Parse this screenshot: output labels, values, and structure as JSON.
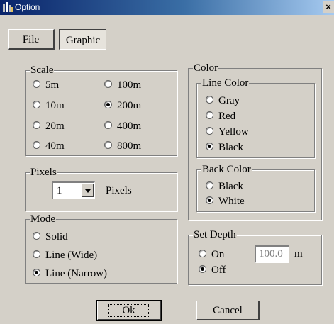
{
  "window": {
    "title": "Option",
    "close_label": "×"
  },
  "tabs": [
    {
      "label": "File",
      "active": false
    },
    {
      "label": "Graphic",
      "active": true
    }
  ],
  "scale": {
    "legend": "Scale",
    "options": [
      "5m",
      "10m",
      "20m",
      "40m",
      "100m",
      "200m",
      "400m",
      "800m"
    ],
    "selected": "200m"
  },
  "pixels": {
    "legend": "Pixels",
    "value": "1",
    "unit": "Pixels"
  },
  "mode": {
    "legend": "Mode",
    "options": [
      "Solid",
      "Line (Wide)",
      "Line (Narrow)"
    ],
    "selected": "Line (Narrow)"
  },
  "color": {
    "legend": "Color",
    "line_color": {
      "legend": "Line Color",
      "options": [
        "Gray",
        "Red",
        "Yellow",
        "Black"
      ],
      "selected": "Black"
    },
    "back_color": {
      "legend": "Back Color",
      "options": [
        "Black",
        "White"
      ],
      "selected": "White"
    }
  },
  "set_depth": {
    "legend": "Set Depth",
    "options": [
      "On",
      "Off"
    ],
    "selected": "Off",
    "value": "100.0",
    "unit": "m"
  },
  "buttons": {
    "ok": "Ok",
    "cancel": "Cancel"
  }
}
